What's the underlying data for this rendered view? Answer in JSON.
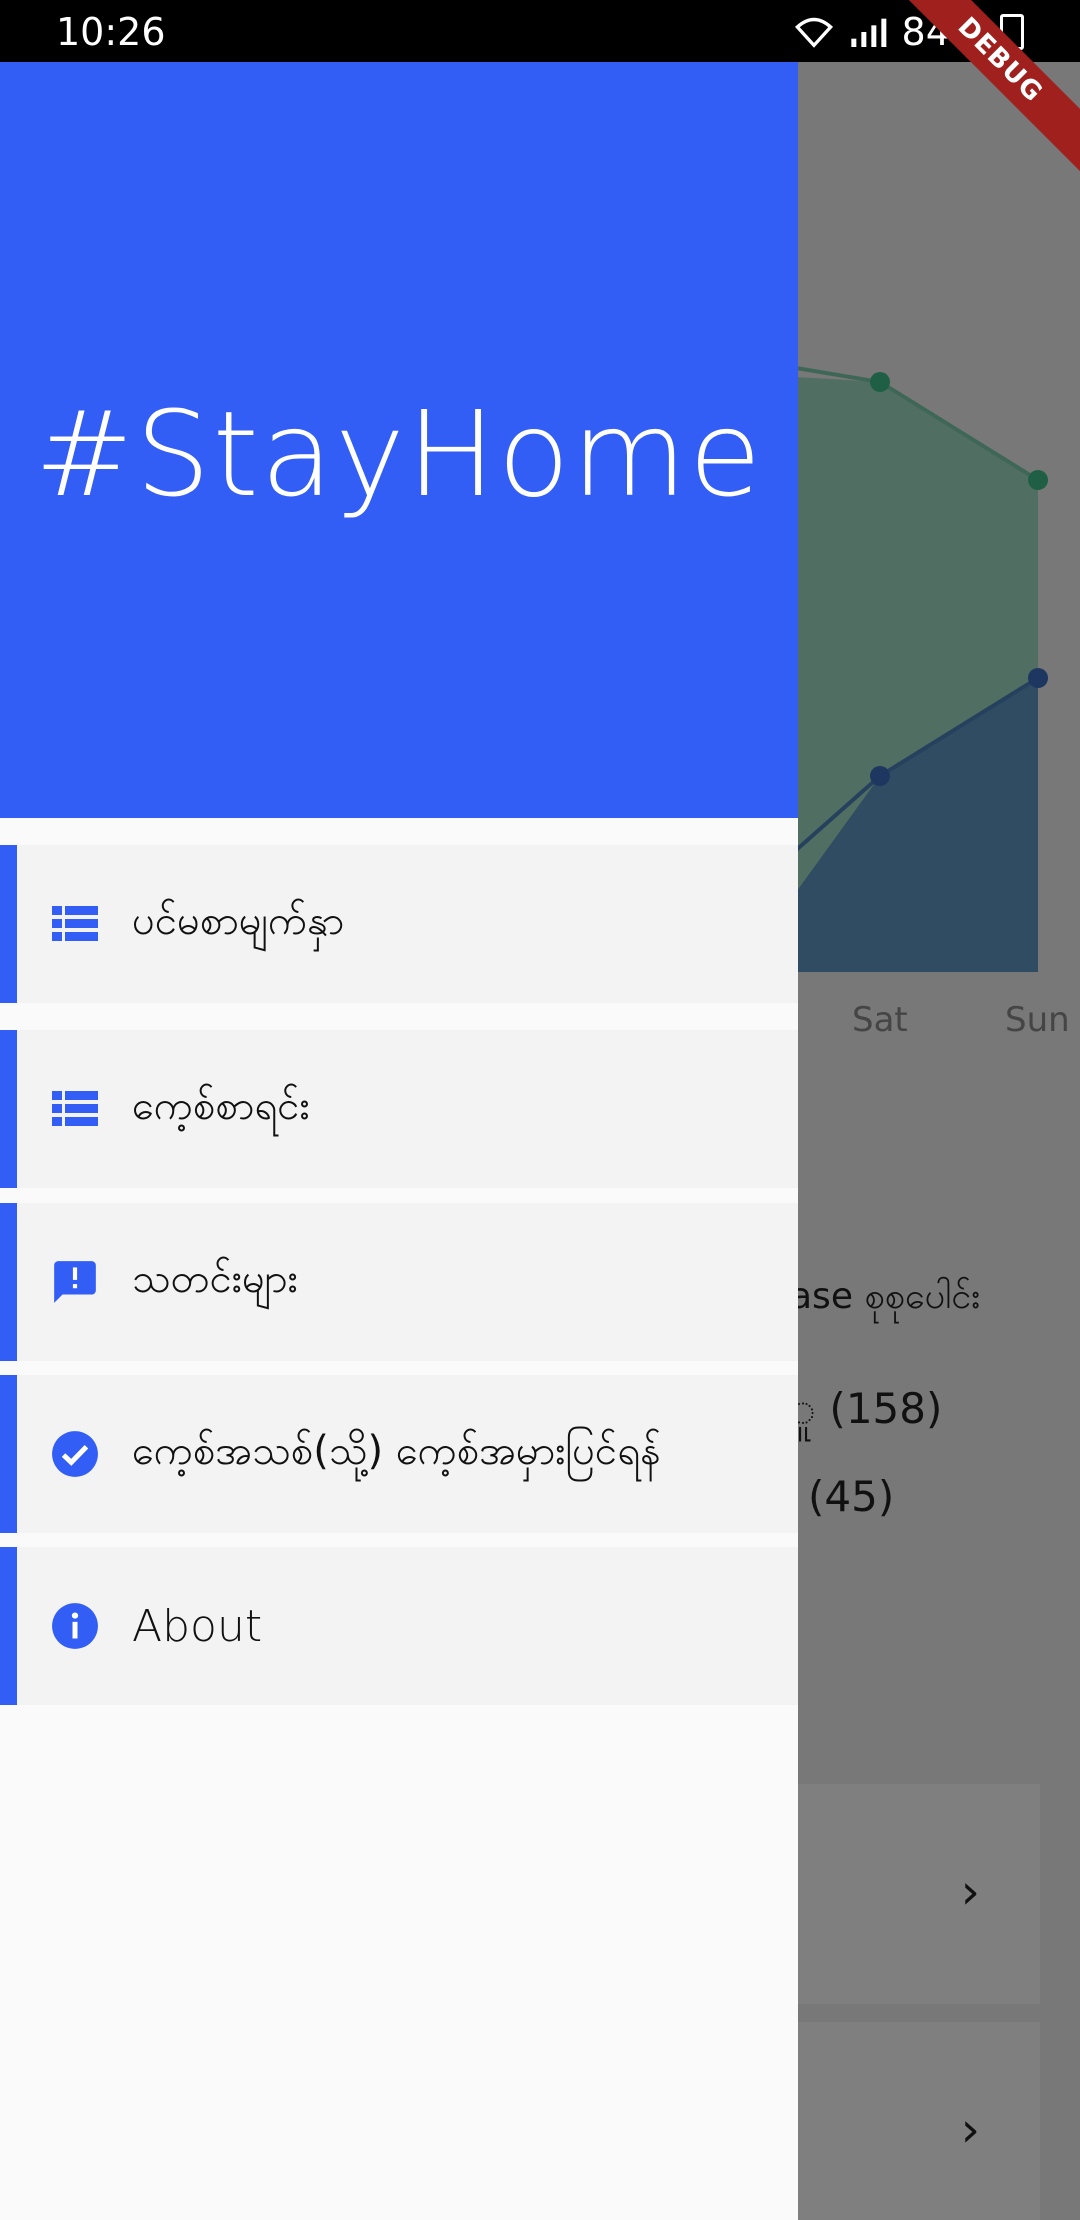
{
  "status_bar": {
    "time": "10:26",
    "battery": "84%",
    "debug": "DEBUG"
  },
  "drawer": {
    "title": "#StayHome",
    "items": [
      {
        "label": "ပင်မစာမျက်နှာ",
        "icon": "view-list-icon"
      },
      {
        "label": "ကေ့စ်စာရင်း",
        "icon": "view-list-icon"
      },
      {
        "label": "သတင်းများ",
        "icon": "feedback-icon"
      },
      {
        "label": "ကေ့စ်အသစ်(သို့) ကေ့စ်အမှားပြင်ရန်",
        "icon": "check-circle-icon"
      },
      {
        "label": "About",
        "icon": "info-icon"
      }
    ]
  },
  "background": {
    "chart_ticks": [
      "Sat",
      "Sun"
    ],
    "text_partial": "ase စုစုပေါင်း",
    "count_1": "ူ (158)",
    "count_2": "(45)"
  },
  "colors": {
    "accent": "#335ef5",
    "header": "#335ef5",
    "scrim": "rgba(0,0,0,0.5)"
  }
}
